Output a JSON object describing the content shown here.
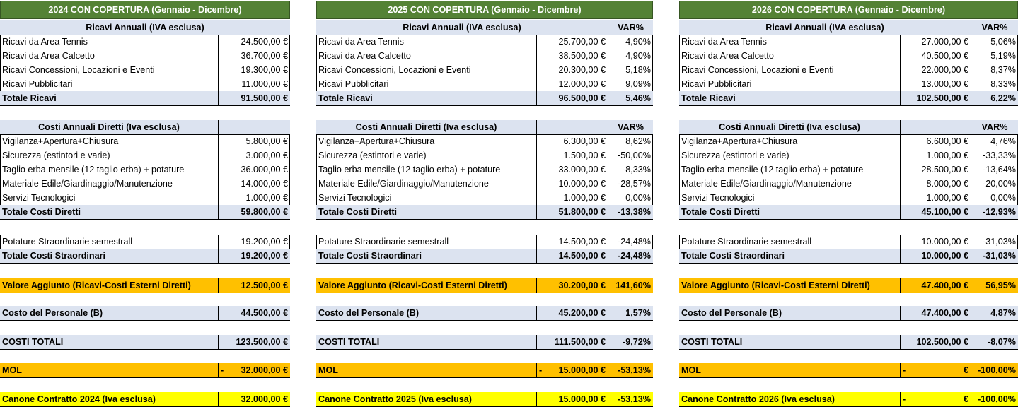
{
  "panels": [
    {
      "title": "2024 CON COPERTURA (Gennaio - Dicembre)",
      "has_var": false,
      "ricavi": {
        "header": "Ricavi Annuali (IVA esclusa)",
        "var_header": "",
        "rows": [
          {
            "label": "Ricavi da Area Tennis",
            "value": "24.500,00 €",
            "var": ""
          },
          {
            "label": "Ricavi da Area Calcetto",
            "value": "36.700,00 €",
            "var": ""
          },
          {
            "label": "Ricavi Concessioni, Locazioni e Eventi",
            "value": "19.300,00 €",
            "var": ""
          },
          {
            "label": "Ricavi Pubblicitari",
            "value": "11.000,00 €",
            "var": ""
          }
        ],
        "total": {
          "label": "Totale Ricavi",
          "value": "91.500,00 €",
          "var": ""
        }
      },
      "costi": {
        "header": "Costi Annuali Diretti (Iva esclusa)",
        "var_header": "",
        "rows": [
          {
            "label": "Vigilanza+Apertura+Chiusura",
            "value": "5.800,00 €",
            "var": ""
          },
          {
            "label": "Sicurezza (estintori e varie)",
            "value": "3.000,00 €",
            "var": ""
          },
          {
            "label": "Taglio erba mensile (12 taglio erba) + potature",
            "value": "36.000,00 €",
            "var": ""
          },
          {
            "label": "Materiale Edile/Giardinaggio/Manutenzione",
            "value": "14.000,00 €",
            "var": ""
          },
          {
            "label": "Servizi Tecnologici",
            "value": "1.000,00 €",
            "var": ""
          }
        ],
        "total": {
          "label": "Totale Costi Diretti",
          "value": "59.800,00 €",
          "var": ""
        }
      },
      "straord": {
        "row": {
          "label": "Potature Straordinarie semestrall",
          "value": "19.200,00 €",
          "var": ""
        },
        "total": {
          "label": "Totale Costi Straordinari",
          "value": "19.200,00 €",
          "var": ""
        }
      },
      "valore": {
        "label": "Valore Aggiunto (Ricavi-Costi Esterni Diretti)",
        "value": "12.500,00 €",
        "var": ""
      },
      "personale": {
        "label": "Costo del Personale (B)",
        "value": "44.500,00 €",
        "var": ""
      },
      "costi_totali": {
        "label": "COSTI TOTALI",
        "value": "123.500,00 €",
        "var": ""
      },
      "mol": {
        "label": "MOL",
        "dash": "-",
        "value": "32.000,00 €",
        "var": ""
      },
      "canone": {
        "label": "Canone Contratto 2024 (Iva esclusa)",
        "dash": "",
        "value": "32.000,00 €",
        "var": ""
      }
    },
    {
      "title": "2025 CON COPERTURA (Gennaio - Dicembre)",
      "has_var": true,
      "ricavi": {
        "header": "Ricavi Annuali (IVA esclusa)",
        "var_header": "VAR%",
        "rows": [
          {
            "label": "Ricavi da Area Tennis",
            "value": "25.700,00 €",
            "var": "4,90%"
          },
          {
            "label": "Ricavi da Area Calcetto",
            "value": "38.500,00 €",
            "var": "4,90%"
          },
          {
            "label": "Ricavi Concessioni, Locazioni e Eventi",
            "value": "20.300,00 €",
            "var": "5,18%"
          },
          {
            "label": "Ricavi Pubblicitari",
            "value": "12.000,00 €",
            "var": "9,09%"
          }
        ],
        "total": {
          "label": "Totale Ricavi",
          "value": "96.500,00 €",
          "var": "5,46%"
        }
      },
      "costi": {
        "header": "Costi Annuali Diretti (Iva esclusa)",
        "var_header": "VAR%",
        "rows": [
          {
            "label": "Vigilanza+Apertura+Chiusura",
            "value": "6.300,00 €",
            "var": "8,62%"
          },
          {
            "label": "Sicurezza (estintori e varie)",
            "value": "1.500,00 €",
            "var": "-50,00%"
          },
          {
            "label": "Taglio erba mensile (12 taglio erba) + potature",
            "value": "33.000,00 €",
            "var": "-8,33%"
          },
          {
            "label": "Materiale Edile/Giardinaggio/Manutenzione",
            "value": "10.000,00 €",
            "var": "-28,57%"
          },
          {
            "label": "Servizi Tecnologici",
            "value": "1.000,00 €",
            "var": "0,00%"
          }
        ],
        "total": {
          "label": "Totale Costi Diretti",
          "value": "51.800,00 €",
          "var": "-13,38%"
        }
      },
      "straord": {
        "row": {
          "label": "Potature Straordinarie semestrall",
          "value": "14.500,00 €",
          "var": "-24,48%"
        },
        "total": {
          "label": "Totale Costi Straordinari",
          "value": "14.500,00 €",
          "var": "-24,48%"
        }
      },
      "valore": {
        "label": "Valore Aggiunto (Ricavi-Costi Esterni Diretti)",
        "value": "30.200,00 €",
        "var": "141,60%"
      },
      "personale": {
        "label": "Costo del Personale (B)",
        "value": "45.200,00 €",
        "var": "1,57%"
      },
      "costi_totali": {
        "label": "COSTI TOTALI",
        "value": "111.500,00 €",
        "var": "-9,72%"
      },
      "mol": {
        "label": "MOL",
        "dash": "-",
        "value": "15.000,00 €",
        "var": "-53,13%"
      },
      "canone": {
        "label": "Canone Contratto 2025 (Iva esclusa)",
        "dash": "",
        "value": "15.000,00 €",
        "var": "-53,13%"
      }
    },
    {
      "title": "2026 CON COPERTURA (Gennaio - Dicembre)",
      "has_var": true,
      "ricavi": {
        "header": "Ricavi Annuali (IVA esclusa)",
        "var_header": "VAR%",
        "rows": [
          {
            "label": "Ricavi da Area Tennis",
            "value": "27.000,00 €",
            "var": "5,06%"
          },
          {
            "label": "Ricavi da Area Calcetto",
            "value": "40.500,00 €",
            "var": "5,19%"
          },
          {
            "label": "Ricavi Concessioni, Locazioni e Eventi",
            "value": "22.000,00 €",
            "var": "8,37%"
          },
          {
            "label": "Ricavi Pubblicitari",
            "value": "13.000,00 €",
            "var": "8,33%"
          }
        ],
        "total": {
          "label": "Totale Ricavi",
          "value": "102.500,00 €",
          "var": "6,22%"
        }
      },
      "costi": {
        "header": "Costi Annuali Diretti (Iva esclusa)",
        "var_header": "VAR%",
        "rows": [
          {
            "label": "Vigilanza+Apertura+Chiusura",
            "value": "6.600,00 €",
            "var": "4,76%"
          },
          {
            "label": "Sicurezza (estintori e varie)",
            "value": "1.000,00 €",
            "var": "-33,33%"
          },
          {
            "label": "Taglio erba mensile (12 taglio erba) + potature",
            "value": "28.500,00 €",
            "var": "-13,64%"
          },
          {
            "label": "Materiale Edile/Giardinaggio/Manutenzione",
            "value": "8.000,00 €",
            "var": "-20,00%"
          },
          {
            "label": "Servizi Tecnologici",
            "value": "1.000,00 €",
            "var": "0,00%"
          }
        ],
        "total": {
          "label": "Totale Costi Diretti",
          "value": "45.100,00 €",
          "var": "-12,93%"
        }
      },
      "straord": {
        "row": {
          "label": "Potature Straordinarie semestrall",
          "value": "10.000,00 €",
          "var": "-31,03%"
        },
        "total": {
          "label": "Totale Costi Straordinari",
          "value": "10.000,00 €",
          "var": "-31,03%"
        }
      },
      "valore": {
        "label": "Valore Aggiunto (Ricavi-Costi Esterni Diretti)",
        "value": "47.400,00 €",
        "var": "56,95%"
      },
      "personale": {
        "label": "Costo del Personale (B)",
        "value": "47.400,00 €",
        "var": "4,87%"
      },
      "costi_totali": {
        "label": "COSTI TOTALI",
        "value": "102.500,00 €",
        "var": "-8,07%"
      },
      "mol": {
        "label": "MOL",
        "dash": "-",
        "value": "€",
        "var": "-100,00%"
      },
      "canone": {
        "label": "Canone Contratto 2026 (Iva esclusa)",
        "dash": "-",
        "value": "€",
        "var": "-100,00%"
      }
    }
  ],
  "colors": {
    "title_green": "#548235",
    "header_blue": "#dce3f0",
    "orange": "#ffc000",
    "yellow": "#ffff00"
  }
}
